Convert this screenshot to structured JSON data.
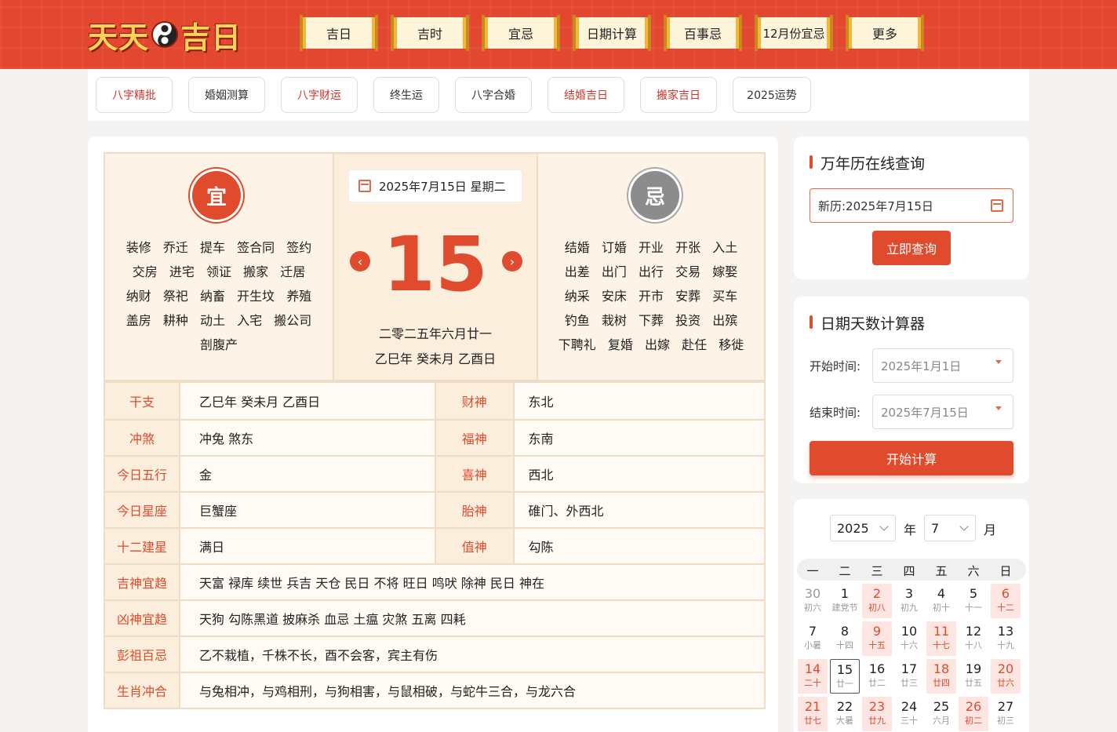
{
  "header": {
    "logo_text_left": "天天",
    "logo_text_right": "吉日",
    "nav": [
      "吉日",
      "吉时",
      "宜忌",
      "日期计算",
      "百事忌",
      "12月份宜忌",
      "更多"
    ]
  },
  "subnav": [
    {
      "label": "八字精批",
      "red": true
    },
    {
      "label": "婚姻测算",
      "red": false
    },
    {
      "label": "八字财运",
      "red": true
    },
    {
      "label": "终生运",
      "red": false
    },
    {
      "label": "八字合婚",
      "red": false
    },
    {
      "label": "结婚吉日",
      "red": true
    },
    {
      "label": "搬家吉日",
      "red": true
    },
    {
      "label": "2025运势",
      "red": false
    }
  ],
  "almanac": {
    "yi_badge": "宜",
    "ji_badge": "忌",
    "yi": [
      "装修",
      "乔迁",
      "提车",
      "签合同",
      "签约",
      "交房",
      "进宅",
      "领证",
      "搬家",
      "迁居",
      "纳财",
      "祭祀",
      "纳畜",
      "开生坟",
      "养殖",
      "盖房",
      "耕种",
      "动土",
      "入宅",
      "搬公司",
      "剖腹产"
    ],
    "ji": [
      "结婚",
      "订婚",
      "开业",
      "开张",
      "入土",
      "出差",
      "出门",
      "出行",
      "交易",
      "嫁娶",
      "纳采",
      "安床",
      "开市",
      "安葬",
      "买车",
      "钓鱼",
      "栽树",
      "下葬",
      "投资",
      "出殡",
      "下聘礼",
      "复婚",
      "出嫁",
      "赴任",
      "移徙"
    ],
    "date_label": "2025年7月15日 星期二",
    "day": "15",
    "lunar_line1": "二零二五年六月廿一",
    "lunar_line2": "乙巳年 癸未月 乙酉日",
    "prev": "‹",
    "next": "›"
  },
  "info_pairs": [
    {
      "l1": "干支",
      "v1": "乙巳年 癸未月 乙酉日",
      "l2": "财神",
      "v2": "东北"
    },
    {
      "l1": "冲煞",
      "v1": "冲兔 煞东",
      "l2": "福神",
      "v2": "东南"
    },
    {
      "l1": "今日五行",
      "v1": "金",
      "l2": "喜神",
      "v2": "西北"
    },
    {
      "l1": "今日星座",
      "v1": "巨蟹座",
      "l2": "胎神",
      "v2": "碓门、外西北"
    },
    {
      "l1": "十二建星",
      "v1": "满日",
      "l2": "值神",
      "v2": "勾陈"
    }
  ],
  "info_full": [
    {
      "label": "吉神宜趋",
      "value": "天富 禄库 续世 兵吉 天仓 民日 不将 旺日 鸣吠 除神 民日 神在"
    },
    {
      "label": "凶神宜趋",
      "value": "天狗 勾陈黑道 披麻杀 血忌 土瘟 灾煞 五离 四耗"
    },
    {
      "label": "彭祖百忌",
      "value": "乙不栽植，千株不长，酉不会客，宾主有伤"
    },
    {
      "label": "生肖冲合",
      "value": "与兔相冲，与鸡相刑，与狗相害，与鼠相破，与蛇牛三合，与龙六合"
    }
  ],
  "sidebar": {
    "query_title": "万年历在线查询",
    "query_value": "新历:2025年7月15日",
    "query_button": "立即查询",
    "calc_title": "日期天数计算器",
    "start_label": "开始时间:",
    "start_value": "2025年1月1日",
    "end_label": "结束时间:",
    "end_value": "2025年7月15日",
    "calc_button": "开始计算"
  },
  "calendar": {
    "year": "2025",
    "year_label": "年",
    "month": "7",
    "month_label": "月",
    "weekdays": [
      "一",
      "二",
      "三",
      "四",
      "五",
      "六",
      "日"
    ],
    "weeks": [
      [
        {
          "d": "30",
          "l": "初六",
          "t": "other"
        },
        {
          "d": "1",
          "l": "建党节",
          "t": ""
        },
        {
          "d": "2",
          "l": "初八",
          "t": "hol"
        },
        {
          "d": "3",
          "l": "初九",
          "t": ""
        },
        {
          "d": "4",
          "l": "初十",
          "t": ""
        },
        {
          "d": "5",
          "l": "十一",
          "t": ""
        },
        {
          "d": "6",
          "l": "十二",
          "t": "hol"
        }
      ],
      [
        {
          "d": "7",
          "l": "小暑",
          "t": ""
        },
        {
          "d": "8",
          "l": "十四",
          "t": ""
        },
        {
          "d": "9",
          "l": "十五",
          "t": "hol"
        },
        {
          "d": "10",
          "l": "十六",
          "t": ""
        },
        {
          "d": "11",
          "l": "十七",
          "t": "hol"
        },
        {
          "d": "12",
          "l": "十八",
          "t": ""
        },
        {
          "d": "13",
          "l": "十九",
          "t": ""
        }
      ],
      [
        {
          "d": "14",
          "l": "二十",
          "t": "hol"
        },
        {
          "d": "15",
          "l": "廿一",
          "t": "today"
        },
        {
          "d": "16",
          "l": "廿二",
          "t": ""
        },
        {
          "d": "17",
          "l": "廿三",
          "t": ""
        },
        {
          "d": "18",
          "l": "廿四",
          "t": "hol"
        },
        {
          "d": "19",
          "l": "廿五",
          "t": ""
        },
        {
          "d": "20",
          "l": "廿六",
          "t": "hol"
        }
      ],
      [
        {
          "d": "21",
          "l": "廿七",
          "t": "hol"
        },
        {
          "d": "22",
          "l": "大暑",
          "t": ""
        },
        {
          "d": "23",
          "l": "廿九",
          "t": "hol"
        },
        {
          "d": "24",
          "l": "三十",
          "t": ""
        },
        {
          "d": "25",
          "l": "六月",
          "t": ""
        },
        {
          "d": "26",
          "l": "初二",
          "t": "hol"
        },
        {
          "d": "27",
          "l": "初三",
          "t": ""
        }
      ]
    ]
  }
}
